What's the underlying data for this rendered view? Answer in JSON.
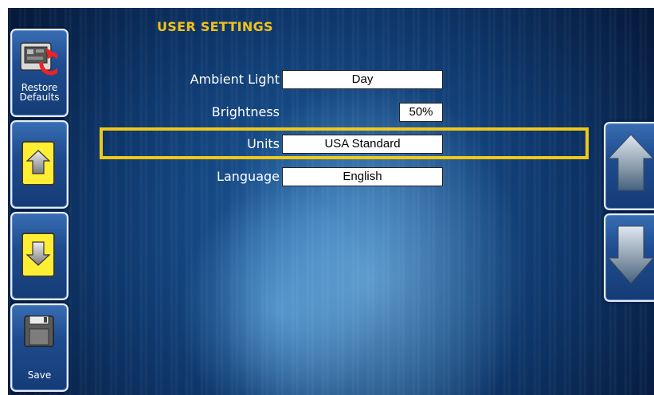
{
  "page": {
    "title": "USER SETTINGS"
  },
  "left_buttons": {
    "restore_label_line1": "Restore",
    "restore_label_line2": "Defaults",
    "save_label": "Save"
  },
  "settings": [
    {
      "label": "Ambient Light",
      "value": "Day"
    },
    {
      "label": "Brightness",
      "value": "50%"
    },
    {
      "label": "Units",
      "value": "USA Standard",
      "selected": true
    },
    {
      "label": "Language",
      "value": "English"
    }
  ],
  "colors": {
    "title": "#f2c21a",
    "selection": "#f0c817",
    "arrow_button_fill": "#ffee33"
  },
  "icons": {
    "restore": "restore-defaults-icon",
    "up_small": "up-arrow-icon",
    "down_small": "down-arrow-icon",
    "save": "save-disk-icon",
    "up_large": "up-arrow-large-icon",
    "down_large": "down-arrow-large-icon"
  }
}
